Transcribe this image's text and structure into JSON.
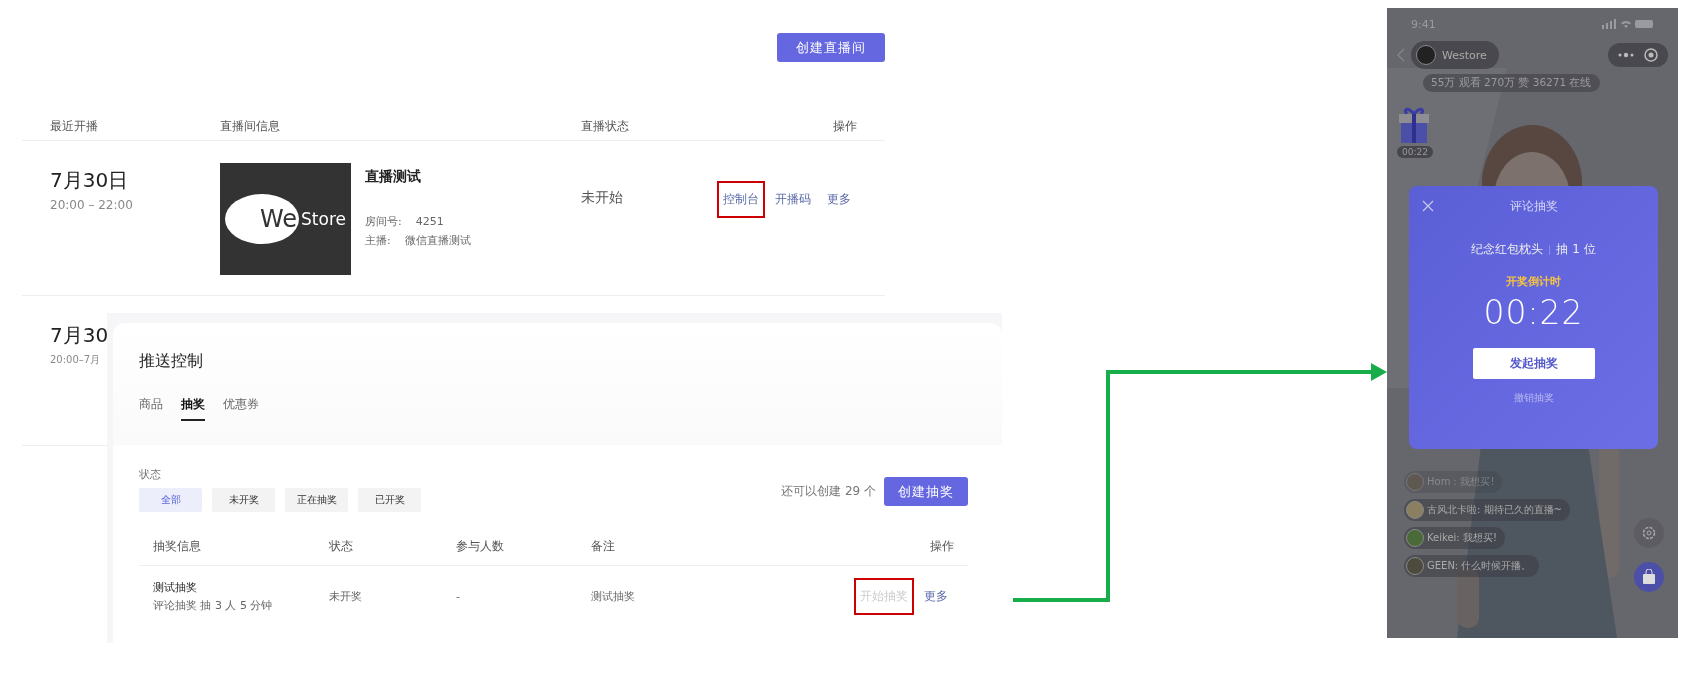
{
  "create_button": "创建直播间",
  "table": {
    "columns": [
      "最近开播",
      "直播间信息",
      "直播状态",
      "操作"
    ],
    "rows": [
      {
        "date": "7月30日",
        "time": "20:00 – 22:00",
        "logo": {
          "mark": "We",
          "word": "Store"
        },
        "title": "直播测试",
        "room_label": "房间号:",
        "room": "4251",
        "host_label": "主播:",
        "host": "微信直播测试",
        "status": "未开始",
        "actions": [
          {
            "label": "控制台",
            "highlighted": true
          },
          {
            "label": "开播码",
            "highlighted": false
          },
          {
            "label": "更多",
            "highlighted": false
          }
        ]
      }
    ],
    "peek_row": {
      "date": "7月30",
      "time": "20:00–7月"
    }
  },
  "panel": {
    "title": "推送控制",
    "tabs": [
      {
        "label": "商品",
        "selected": false
      },
      {
        "label": "抽奖",
        "selected": true
      },
      {
        "label": "优惠券",
        "selected": false
      }
    ],
    "filter_label": "状态",
    "filters": [
      {
        "label": "全部",
        "selected": true
      },
      {
        "label": "未开奖",
        "selected": false
      },
      {
        "label": "正在抽奖",
        "selected": false
      },
      {
        "label": "已开奖",
        "selected": false
      }
    ],
    "quota": "还可以创建 29 个",
    "create_button": "创建抽奖",
    "columns": [
      "抽奖信息",
      "状态",
      "参与人数",
      "备注",
      "操作"
    ],
    "rows": [
      {
        "name": "测试抽奖",
        "detail": "评论抽奖 抽 3 人  5 分钟",
        "status": "未开奖",
        "participants": "-",
        "note": "测试抽奖",
        "actions": [
          {
            "label": "开始抽奖",
            "disabled": true,
            "highlighted": true
          },
          {
            "label": "更多",
            "disabled": false,
            "highlighted": false
          }
        ]
      }
    ]
  },
  "phone": {
    "time": "9:41",
    "account": "Westore",
    "stats": "55万 观看  270万 赞  36271 在线",
    "gift_timer": "00:22",
    "modal": {
      "title": "评论抽奖",
      "prize": "纪念红包枕头",
      "count": "抽 1 位",
      "countdown_label": "开奖倒计时",
      "countdown": "00:22",
      "button": "发起抽奖",
      "cancel": "撤销抽奖"
    },
    "comments": [
      {
        "text": "Hom：我想买!",
        "faded": true
      },
      {
        "text": "古风北卡啦: 期待已久的直播~",
        "faded": false
      },
      {
        "text": "Keikei: 我想买!",
        "faded": false
      },
      {
        "text": "GEEN: 什么时候开播。",
        "faded": false
      }
    ]
  }
}
